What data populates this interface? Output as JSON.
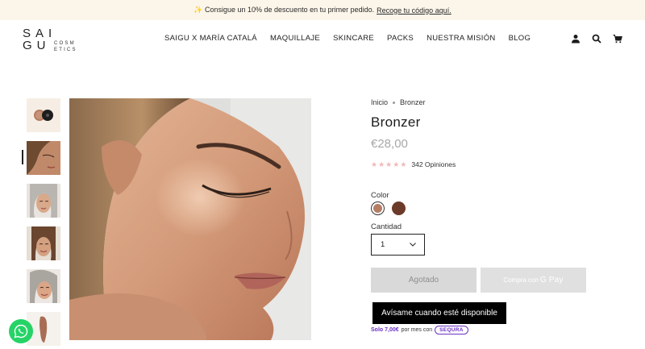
{
  "announcement": {
    "icon": "sparkles-icon",
    "text": "✨ Consigue un 10% de descuento en tu primer pedido.",
    "link": "Recoge tu código aquí."
  },
  "logo": {
    "line1": "SAI",
    "line2": "GU",
    "small1": "COSM",
    "small2": "ETICS"
  },
  "nav": {
    "items": [
      {
        "label": "SAIGU X MARÍA CATALÁ"
      },
      {
        "label": "MAQUILLAJE"
      },
      {
        "label": "SKINCARE"
      },
      {
        "label": "PACKS"
      },
      {
        "label": "NUESTRA MISIÓN"
      },
      {
        "label": "BLOG"
      }
    ]
  },
  "header_icons": [
    "account-icon",
    "search-icon",
    "cart-icon"
  ],
  "breadcrumb": {
    "home": "Inicio",
    "current": "Bronzer"
  },
  "product": {
    "title": "Bronzer",
    "price": "€28,00",
    "rating": 5,
    "reviews": "342 Opiniones",
    "color_label": "Color",
    "colors": [
      "#b57d64",
      "#6b3a29"
    ],
    "selected_color_index": 0,
    "quantity_label": "Cantidad",
    "quantity": "1",
    "sold_out_label": "Agotado",
    "gpay_prefix": "Compra con",
    "gpay_label": "G Pay",
    "notify_label": "Avísame cuando esté disponible"
  },
  "financing": {
    "amount": "Solo 7,00€",
    "text": "por mes con",
    "brand": "SEQURA"
  },
  "colors": {
    "announcement_bg": "#fcf5ea",
    "star": "#f1b8b8",
    "financing": "#6b31c4",
    "whatsapp": "#25d366"
  }
}
